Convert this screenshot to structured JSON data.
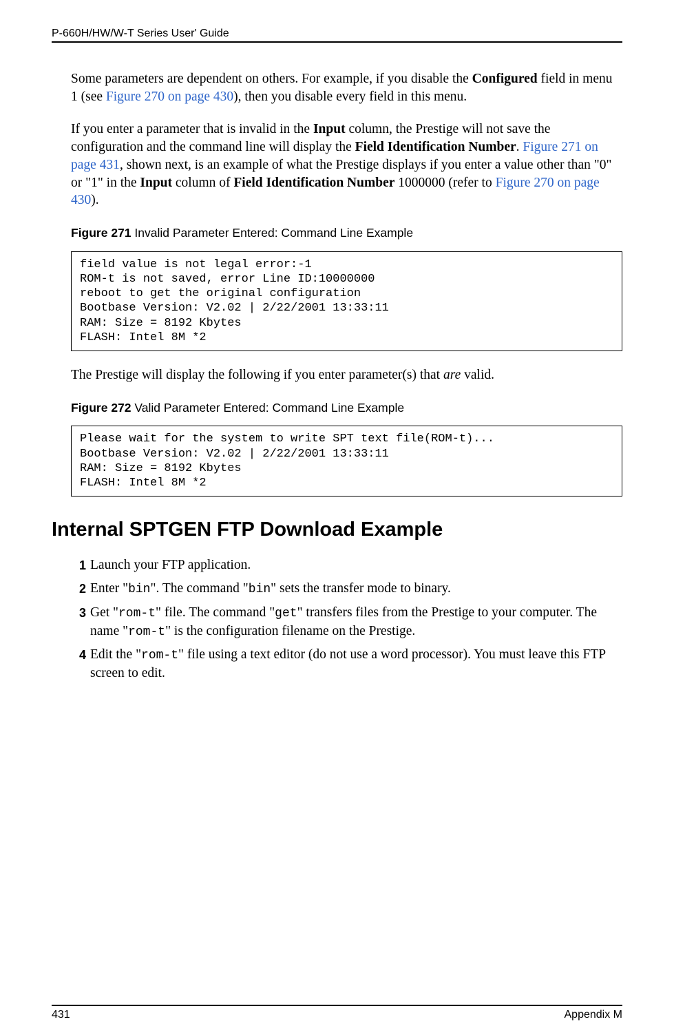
{
  "header": {
    "title": "P-660H/HW/W-T Series User' Guide"
  },
  "paragraphs": {
    "p1_a": "Some parameters are dependent on others. For example, if you disable the ",
    "p1_b": "Configured",
    "p1_c": " field in menu 1 (see ",
    "p1_link1": "Figure 270 on page 430",
    "p1_d": "), then you disable every field in this menu.",
    "p2_a": "If you enter a parameter that is invalid in the ",
    "p2_b": "Input",
    "p2_c": " column, the Prestige will not save the configuration and the command line will display the ",
    "p2_d": "Field Identification Number",
    "p2_e": ". ",
    "p2_link1": "Figure 271 on page 431",
    "p2_f": ", shown next, is an example of what the Prestige displays if you enter a value other than \"0\" or \"1\" in the ",
    "p2_g": "Input",
    "p2_h": " column of ",
    "p2_i": "Field Identification Number",
    "p2_j": " 1000000 (refer to ",
    "p2_link2": "Figure 270 on page 430",
    "p2_k": ").",
    "p3_a": "The Prestige will display the following if you enter parameter(s) that ",
    "p3_b": "are",
    "p3_c": " valid."
  },
  "figures": {
    "f271_label": "Figure 271",
    "f271_title": "   Invalid Parameter Entered: Command Line Example",
    "f272_label": "Figure 272",
    "f272_title": "   Valid Parameter Entered: Command Line Example"
  },
  "code": {
    "box1": "field value is not legal error:-1\nROM-t is not saved, error Line ID:10000000\nreboot to get the original configuration\nBootbase Version: V2.02 | 2/22/2001 13:33:11\nRAM: Size = 8192 Kbytes\nFLASH: Intel 8M *2",
    "box2": "Please wait for the system to write SPT text file(ROM-t)...\nBootbase Version: V2.02 | 2/22/2001 13:33:11\nRAM: Size = 8192 Kbytes\nFLASH: Intel 8M *2"
  },
  "section_heading": "Internal SPTGEN FTP Download Example",
  "list": {
    "n1": "1",
    "n2": "2",
    "n3": "3",
    "n4": "4",
    "li1": "Launch your FTP application.",
    "li2_a": "Enter \"",
    "li2_b": "bin",
    "li2_c": "\". The command \"",
    "li2_d": "bin",
    "li2_e": "\" sets the transfer mode to binary.",
    "li3_a": "Get \"",
    "li3_b": "rom-t",
    "li3_c": "\" file. The command \"",
    "li3_d": "get",
    "li3_e": "\" transfers files from the Prestige to your computer. The name \"",
    "li3_f": "rom-t",
    "li3_g": "\" is the configuration filename on the Prestige.",
    "li4_a": "Edit the \"",
    "li4_b": "rom-t",
    "li4_c": "\" file using a text editor (do not use a word processor). You must leave this FTP screen to edit."
  },
  "footer": {
    "page": "431",
    "appendix": "Appendix M"
  }
}
